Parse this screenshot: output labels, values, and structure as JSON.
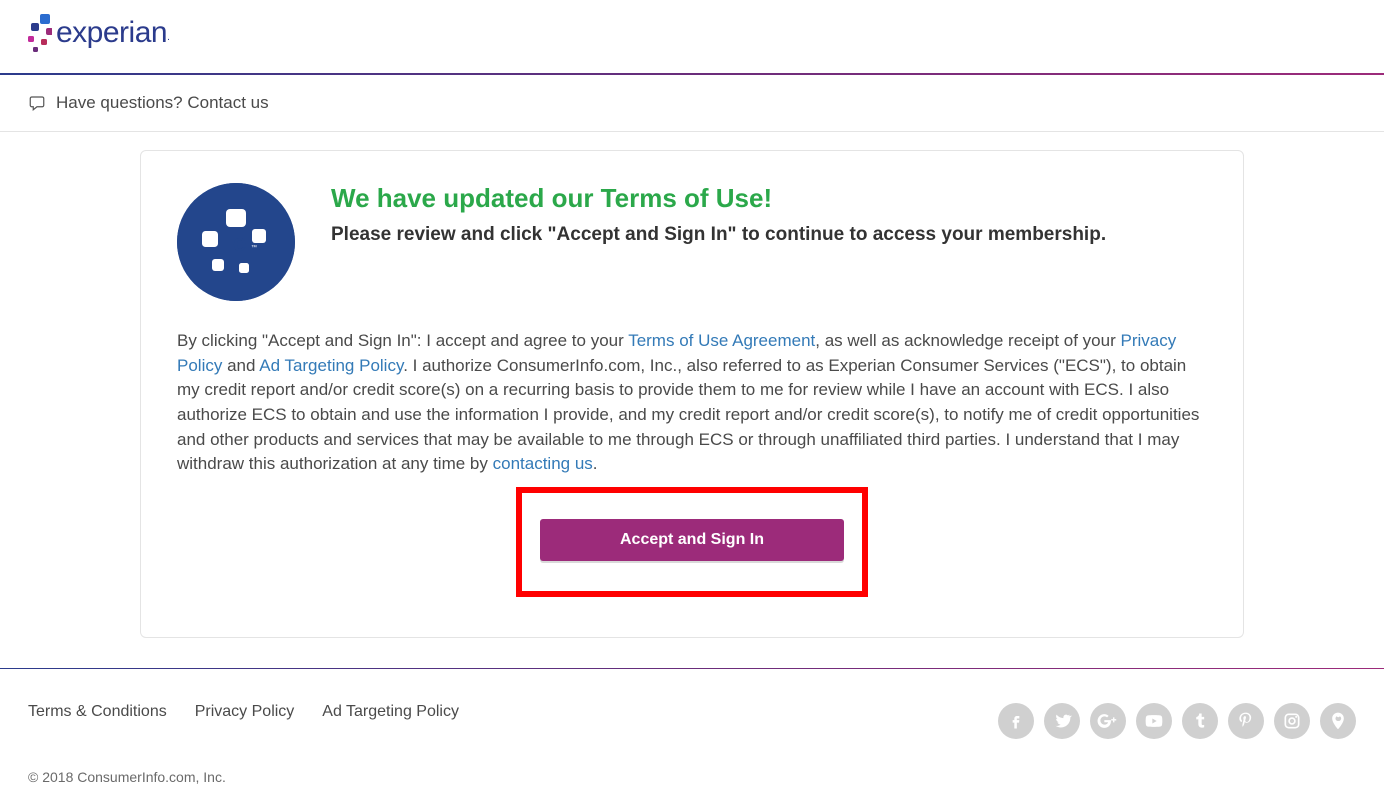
{
  "header": {
    "brand": "experian",
    "contact_text": "Have questions? Contact us"
  },
  "card": {
    "title": "We have updated our Terms of Use!",
    "subtitle": "Please review and click \"Accept and Sign In\" to continue to access your membership.",
    "body_prefix": "By clicking \"Accept and Sign In\": I accept and agree to your ",
    "link_terms": "Terms of Use Agreement",
    "body_after_terms": ", as well as acknowledge receipt of your ",
    "link_privacy": "Privacy Policy",
    "text_and": " and ",
    "link_adtarget": "Ad Targeting Policy",
    "body_middle": ". I authorize ConsumerInfo.com, Inc., also referred to as Experian Consumer Services (\"ECS\"), to obtain my credit report and/or credit score(s) on a recurring basis to provide them to me for review while I have an account with ECS. I also authorize ECS to obtain and use the information I provide, and my credit report and/or credit score(s), to notify me of credit opportunities and other products and services that may be available to me through ECS or through unaffiliated third parties. I understand that I may withdraw this authorization at any time by ",
    "link_contacting": "contacting us",
    "body_end": ".",
    "button_label": "Accept and Sign In"
  },
  "footer": {
    "links": {
      "terms": "Terms & Conditions",
      "privacy": "Privacy Policy",
      "adtarget": "Ad Targeting Policy"
    },
    "social": {
      "facebook": "f",
      "twitter": "t",
      "google": "g+",
      "youtube": "yt",
      "tumblr": "t",
      "pinterest": "p",
      "instagram": "ig",
      "periscope": "p"
    },
    "copyright": "© 2018 ConsumerInfo.com, Inc."
  }
}
